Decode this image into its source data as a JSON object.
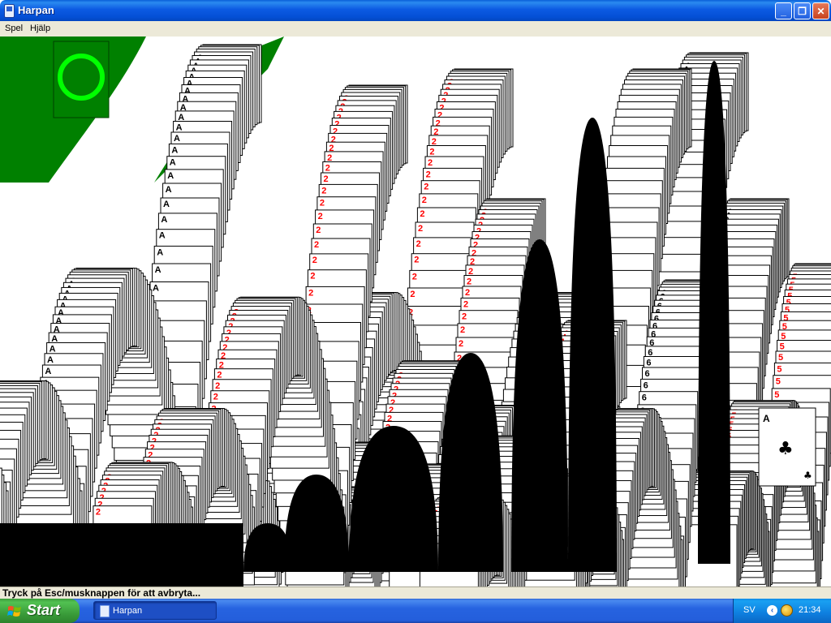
{
  "window": {
    "title": "Harpan",
    "minimize_symbol": "_",
    "maximize_symbol": "❐",
    "close_symbol": "✕"
  },
  "menu": {
    "items": [
      "Spel",
      "Hjälp"
    ]
  },
  "status": {
    "text": "Tryck på Esc/musknappen för att avbryta..."
  },
  "taskbar": {
    "start_label": "Start",
    "task_label": "Harpan",
    "language": "SV",
    "tray_arrow": "‹",
    "clock": "21:34"
  },
  "colors": {
    "felt": "#008000",
    "ring": "#00ff00",
    "red_suit": "#ff0000",
    "titlebar": "#0a5fd8"
  },
  "icons": [
    "app-icon",
    "minimize-icon",
    "maximize-icon",
    "close-icon",
    "windows-logo-icon",
    "globe-icon"
  ]
}
